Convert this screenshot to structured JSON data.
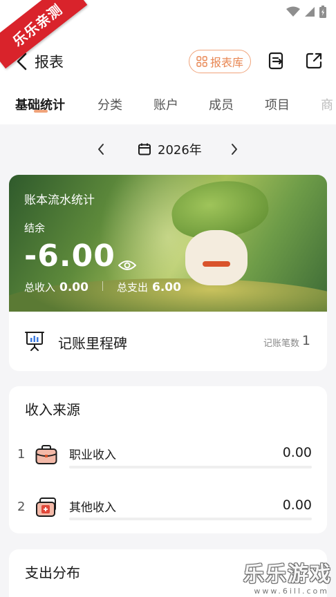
{
  "ribbon_label": "乐乐亲测",
  "header": {
    "title": "报表",
    "library_button": "报表库"
  },
  "tabs": [
    {
      "label": "基础统计",
      "active": true
    },
    {
      "label": "分类"
    },
    {
      "label": "账户"
    },
    {
      "label": "成员"
    },
    {
      "label": "项目"
    },
    {
      "label": "商"
    }
  ],
  "period": {
    "year": "2026年"
  },
  "banner": {
    "title": "账本流水统计",
    "balance_label": "结余",
    "balance_value": "-6.00",
    "income_label": "总收入",
    "income_value": "0.00",
    "expense_label": "总支出",
    "expense_value": "6.00"
  },
  "milestone": {
    "title": "记账里程碑",
    "count_label": "记账笔数",
    "count_value": "1"
  },
  "income": {
    "title": "收入来源",
    "rows": [
      {
        "index": "1",
        "label": "职业收入",
        "value": "0.00",
        "progress": 0
      },
      {
        "index": "2",
        "label": "其他收入",
        "value": "0.00",
        "progress": 0
      }
    ]
  },
  "expense": {
    "title": "支出分布"
  },
  "watermark": {
    "text": "乐乐游戏",
    "sub": "www.6ill.com"
  },
  "colors": {
    "accent": "#e88652",
    "ribbon": "#d9232b"
  }
}
